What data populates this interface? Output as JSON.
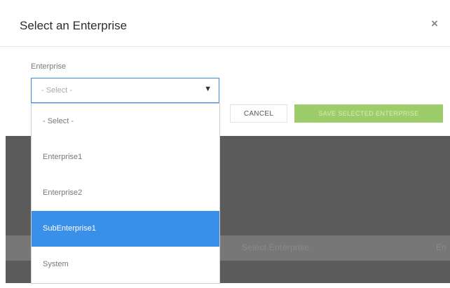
{
  "dialog": {
    "title": "Select an Enterprise",
    "close_glyph": "×"
  },
  "field": {
    "label": "Enterprise",
    "selected_value": "- Select -",
    "arrow_glyph": "▼"
  },
  "dropdown": {
    "options": [
      {
        "label": "- Select -",
        "highlighted": false
      },
      {
        "label": "Enterprise1",
        "highlighted": false
      },
      {
        "label": "Enterprise2",
        "highlighted": false
      },
      {
        "label": "SubEnterprise1",
        "highlighted": true
      },
      {
        "label": "System",
        "highlighted": false
      }
    ]
  },
  "actions": {
    "cancel_label": "CANCEL",
    "save_label": "SAVE SELECTED ENTERPRISE"
  },
  "background": {
    "partial_text_1": "Select Enterprise",
    "partial_text_2": "En"
  },
  "colors": {
    "accent": "#3a8fe8",
    "save_button": "#9ccd6a",
    "overlay": "#5b5b5b"
  }
}
